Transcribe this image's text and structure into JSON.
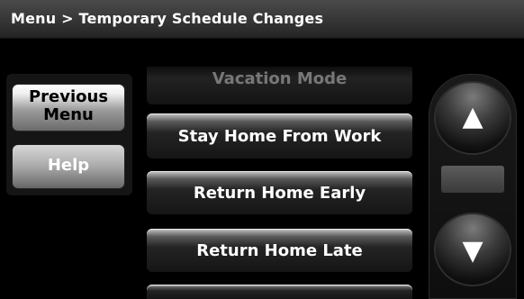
{
  "header": {
    "breadcrumb": "Menu > Temporary Schedule Changes"
  },
  "left_panel": {
    "previous_line1": "Previous",
    "previous_line2": "Menu",
    "help_label": "Help"
  },
  "menu_items": [
    {
      "label": "Vacation Mode"
    },
    {
      "label": "Stay Home From Work"
    },
    {
      "label": "Return Home Early"
    },
    {
      "label": "Return Home Late"
    }
  ],
  "scroll": {
    "up_icon": "▲",
    "down_icon": "▼"
  }
}
